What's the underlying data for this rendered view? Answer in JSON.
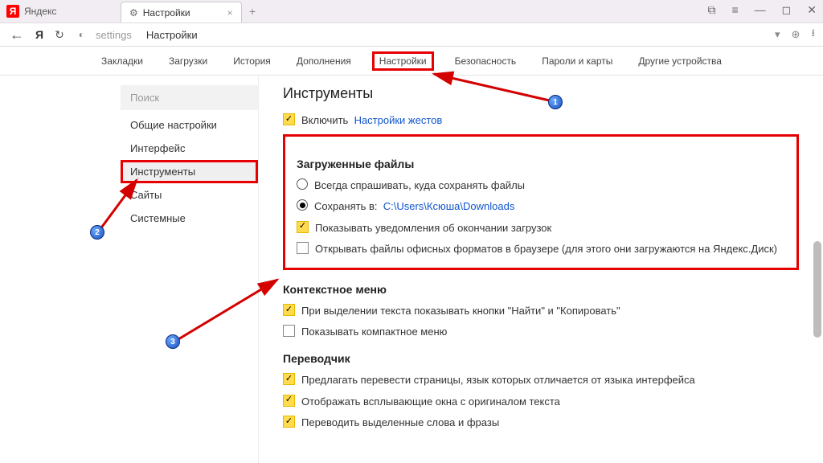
{
  "titlebar": {
    "appname": "Яндекс"
  },
  "tab": {
    "title": "Настройки"
  },
  "toolbar": {
    "url_path": "settings",
    "url_label": "Настройки"
  },
  "topnav": {
    "items": [
      "Закладки",
      "Загрузки",
      "История",
      "Дополнения",
      "Настройки",
      "Безопасность",
      "Пароли и карты",
      "Другие устройства"
    ],
    "active_index": 4
  },
  "sidebar": {
    "search_placeholder": "Поиск",
    "items": [
      "Общие настройки",
      "Интерфейс",
      "Инструменты",
      "Сайты",
      "Системные"
    ],
    "selected_index": 2
  },
  "content": {
    "h_instruments": "Инструменты",
    "enable_label": "Включить",
    "gestures_link": "Настройки жестов",
    "downloads": {
      "heading": "Загруженные файлы",
      "ask": "Всегда спрашивать, куда сохранять файлы",
      "save_in_label": "Сохранять в:",
      "save_path": "C:\\Users\\Ксюша\\Downloads",
      "notify": "Показывать уведомления об окончании загрузок",
      "office": "Открывать файлы офисных форматов в браузере (для этого они загружаются на Яндекс.Диск)"
    },
    "context": {
      "heading": "Контекстное меню",
      "find_copy": "При выделении текста показывать кнопки \"Найти\" и \"Копировать\"",
      "compact": "Показывать компактное меню"
    },
    "translator": {
      "heading": "Переводчик",
      "offer": "Предлагать перевести страницы, язык которых отличается от языка интерфейса",
      "popup": "Отображать всплывающие окна с оригиналом текста",
      "selected": "Переводить выделенные слова и фразы"
    }
  },
  "markers": {
    "m1": "1",
    "m2": "2",
    "m3": "3"
  }
}
